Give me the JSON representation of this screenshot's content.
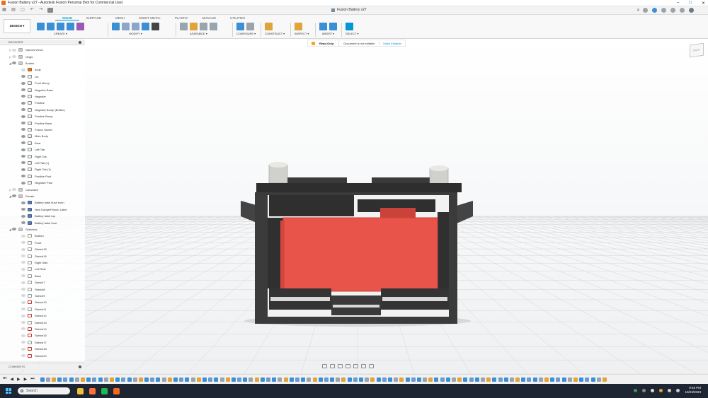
{
  "window": {
    "title": "Fusion Battery v27 - Autodesk Fusion Personal (Not for Commercial Use)",
    "controls": [
      "–",
      "□",
      "✕"
    ]
  },
  "doc_tab": {
    "label": "Fusion Battery v27",
    "close": "✕"
  },
  "workspace": {
    "label": "DESIGN ▾"
  },
  "ribbon_tabs": [
    "SOLID",
    "SURFACE",
    "MESH",
    "SHEET METAL",
    "PLASTIC",
    "MANAGE",
    "UTILITIES"
  ],
  "active_tab": "SOLID",
  "tool_groups": [
    {
      "label": "CREATE ▾",
      "icons": [
        "new-component-icon",
        "extrude-icon",
        "revolve-icon",
        "sweep-icon",
        "create-form-icon"
      ],
      "colors": [
        "#3b8fd4",
        "#3b8fd4",
        "#3b8fd4",
        "#3b8fd4",
        "#9b59b6"
      ]
    },
    {
      "label": "MODIFY ▾",
      "icons": [
        "press-pull-icon",
        "fillet-icon",
        "chamfer-icon",
        "shell-icon",
        "move-icon"
      ],
      "colors": [
        "#3b8fd4",
        "#8aa7c8",
        "#8aa7c8",
        "#3b8fd4",
        "#444444"
      ]
    },
    {
      "label": "ASSEMBLE ▾",
      "icons": [
        "new-component-icon",
        "joint-icon",
        "as-built-joint-icon",
        "joint-origin-icon"
      ],
      "colors": [
        "#9aa4ad",
        "#e0a43a",
        "#9aa4ad",
        "#9aa4ad"
      ]
    },
    {
      "label": "CONFIGURE ▾",
      "icons": [
        "configure-icon",
        "table-icon"
      ],
      "colors": [
        "#3b8fd4",
        "#9aa4ad"
      ]
    },
    {
      "label": "CONSTRUCT ▾",
      "icons": [
        "offset-plane-icon"
      ],
      "colors": [
        "#e0a43a"
      ]
    },
    {
      "label": "INSPECT ▾",
      "icons": [
        "measure-icon"
      ],
      "colors": [
        "#e0a43a"
      ]
    },
    {
      "label": "INSERT ▾",
      "icons": [
        "insert-derive-icon",
        "insert-image-icon"
      ],
      "colors": [
        "#3b8fd4",
        "#3b8fd4"
      ]
    },
    {
      "label": "SELECT ▾",
      "icons": [
        "select-icon"
      ],
      "colors": [
        "#0696d7"
      ]
    }
  ],
  "readonly_bar": {
    "label": "Read-Only:",
    "message": "Document is not editable",
    "action": "Make Editable"
  },
  "browser": {
    "header": "BROWSER",
    "items": [
      {
        "label": "Named Views",
        "level": 0,
        "type": "folder",
        "arrow": "▷",
        "visible": false
      },
      {
        "label": "Origin",
        "level": 0,
        "type": "folder",
        "arrow": "▷",
        "visible": false
      },
      {
        "label": "Bodies",
        "level": 0,
        "type": "folder",
        "arrow": "◢",
        "visible": true
      },
      {
        "label": "body",
        "level": 1,
        "type": "body-orange",
        "arrow": "",
        "visible": false
      },
      {
        "label": "Lid",
        "level": 1,
        "type": "body",
        "arrow": "",
        "visible": true
      },
      {
        "label": "Front Bump",
        "level": 1,
        "type": "body",
        "arrow": "",
        "visible": true
      },
      {
        "label": "Negative Base",
        "level": 1,
        "type": "body",
        "arrow": "",
        "visible": true
      },
      {
        "label": "Negative",
        "level": 1,
        "type": "body",
        "arrow": "",
        "visible": true
      },
      {
        "label": "Positive",
        "level": 1,
        "type": "body",
        "arrow": "",
        "visible": true
      },
      {
        "label": "Negative Bump (Button)",
        "level": 1,
        "type": "body",
        "arrow": "",
        "visible": true
      },
      {
        "label": "Positive Bump",
        "level": 1,
        "type": "body",
        "arrow": "",
        "visible": true
      },
      {
        "label": "Positive Base",
        "level": 1,
        "type": "body",
        "arrow": "",
        "visible": true
      },
      {
        "label": "Fusion Switch",
        "level": 1,
        "type": "body",
        "arrow": "",
        "visible": true
      },
      {
        "label": "Main Body",
        "level": 1,
        "type": "body",
        "arrow": "",
        "visible": true
      },
      {
        "label": "Rear",
        "level": 1,
        "type": "body",
        "arrow": "",
        "visible": true
      },
      {
        "label": "Left Tab",
        "level": 1,
        "type": "body",
        "arrow": "",
        "visible": true
      },
      {
        "label": "Right Tab",
        "level": 1,
        "type": "body",
        "arrow": "",
        "visible": true
      },
      {
        "label": "Left Tab (1)",
        "level": 1,
        "type": "body",
        "arrow": "",
        "visible": true
      },
      {
        "label": "Right Tab (1)",
        "level": 1,
        "type": "body",
        "arrow": "",
        "visible": true
      },
      {
        "label": "Positive Post",
        "level": 1,
        "type": "body",
        "arrow": "",
        "visible": true
      },
      {
        "label": "Negative Post",
        "level": 1,
        "type": "body",
        "arrow": "",
        "visible": true
      },
      {
        "label": "Canvases",
        "level": 0,
        "type": "folder",
        "arrow": "▷",
        "visible": false
      },
      {
        "label": "Decals",
        "level": 0,
        "type": "folder",
        "arrow": "◢",
        "visible": true
      },
      {
        "label": "Battery label flush even",
        "level": 1,
        "type": "decal",
        "arrow": "",
        "visible": true
      },
      {
        "label": "New DangerPoison Label",
        "level": 1,
        "type": "decal",
        "arrow": "",
        "visible": true
      },
      {
        "label": "Battery label top",
        "level": 1,
        "type": "decal",
        "arrow": "",
        "visible": true
      },
      {
        "label": "Battery label front",
        "level": 1,
        "type": "decal",
        "arrow": "",
        "visible": true
      },
      {
        "label": "Sketches",
        "level": 0,
        "type": "folder",
        "arrow": "◢",
        "visible": true
      },
      {
        "label": "Bottom",
        "level": 1,
        "type": "sketch",
        "arrow": "",
        "visible": false
      },
      {
        "label": "Front",
        "level": 1,
        "type": "sketch",
        "arrow": "",
        "visible": false
      },
      {
        "label": "Sketch15",
        "level": 1,
        "type": "sketch",
        "arrow": "",
        "visible": false
      },
      {
        "label": "Sketch16",
        "level": 1,
        "type": "sketch",
        "arrow": "",
        "visible": false
      },
      {
        "label": "Right Side",
        "level": 1,
        "type": "sketch",
        "arrow": "",
        "visible": false
      },
      {
        "label": "Left Side",
        "level": 1,
        "type": "sketch",
        "arrow": "",
        "visible": false
      },
      {
        "label": "Back",
        "level": 1,
        "type": "sketch",
        "arrow": "",
        "visible": false
      },
      {
        "label": "Sketch7",
        "level": 1,
        "type": "sketch",
        "arrow": "",
        "visible": false
      },
      {
        "label": "Sketch8",
        "level": 1,
        "type": "sketch",
        "arrow": "",
        "visible": false
      },
      {
        "label": "Sketch9",
        "level": 1,
        "type": "sketch",
        "arrow": "",
        "visible": false
      },
      {
        "label": "Sketch10",
        "level": 1,
        "type": "sketch-red",
        "arrow": "",
        "visible": false
      },
      {
        "label": "Sketch11",
        "level": 1,
        "type": "sketch",
        "arrow": "",
        "visible": false
      },
      {
        "label": "Sketch12",
        "level": 1,
        "type": "sketch-red",
        "arrow": "",
        "visible": false
      },
      {
        "label": "Sketch13",
        "level": 1,
        "type": "sketch",
        "arrow": "",
        "visible": false
      },
      {
        "label": "Sketch14",
        "level": 1,
        "type": "sketch-red",
        "arrow": "",
        "visible": false
      },
      {
        "label": "Sketch15",
        "level": 1,
        "type": "sketch-red",
        "arrow": "",
        "visible": false
      },
      {
        "label": "Sketch17",
        "level": 1,
        "type": "sketch",
        "arrow": "",
        "visible": false
      },
      {
        "label": "Sketch18",
        "level": 1,
        "type": "sketch-red",
        "arrow": "",
        "visible": false
      },
      {
        "label": "Sketch20",
        "level": 1,
        "type": "sketch-red",
        "arrow": "",
        "visible": false
      }
    ]
  },
  "comments": {
    "label": "COMMENTS"
  },
  "viewcube": {
    "label": "BACK"
  },
  "nav_tools": [
    "orbit-icon",
    "pan-icon",
    "zoom-icon",
    "fit-icon",
    "display-settings-icon",
    "grid-icon",
    "viewports-icon"
  ],
  "timeline": {
    "controls": [
      "⏮",
      "◀",
      "▶",
      "▶",
      "⏭"
    ],
    "item_count": 98
  },
  "taskbar": {
    "search_placeholder": "Search",
    "apps": [
      "file-explorer-icon",
      "firefox-icon",
      "spotify-icon",
      "fusion-icon"
    ],
    "app_colors": [
      "#f0c03a",
      "#ff7139",
      "#1db954",
      "#f26b1d"
    ],
    "time": "9:46 PM",
    "date": "10/23/2023"
  },
  "colors": {
    "accent": "#0696d7",
    "battery_body": "#3a3a3a",
    "battery_label": "#e8544a",
    "fusion_orange": "#f26b1d"
  }
}
